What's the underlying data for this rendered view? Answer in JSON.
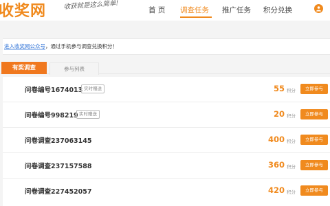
{
  "header": {
    "logo": "收奖网",
    "slogan": "收获就是这么简单!",
    "nav": [
      "首 页",
      "调查任务",
      "推广任务",
      "积分兑换"
    ],
    "active_nav": "调查任务",
    "accent_color": "#f08a1e"
  },
  "notice": {
    "link": "进入收奖网公众号",
    "text": "，通过手机参与调查兑换积分！"
  },
  "tabs": {
    "active": "有奖调查",
    "inactive": "参与列表"
  },
  "surveys": [
    {
      "title": "问卷编号1674013",
      "badge": "实时赠送",
      "points": "55",
      "unit": "积分",
      "action": "立即参与"
    },
    {
      "title": "问卷编号998219",
      "badge": "实时赠送",
      "points": "20",
      "unit": "积分",
      "action": "立即参与"
    },
    {
      "title": "问卷调查237063145",
      "badge": "",
      "points": "400",
      "unit": "积分",
      "action": "立即参与"
    },
    {
      "title": "问卷调查237157588",
      "badge": "",
      "points": "360",
      "unit": "积分",
      "action": "立即参与"
    },
    {
      "title": "问卷调查227452057",
      "badge": "",
      "points": "420",
      "unit": "积分",
      "action": "立即参与"
    }
  ]
}
